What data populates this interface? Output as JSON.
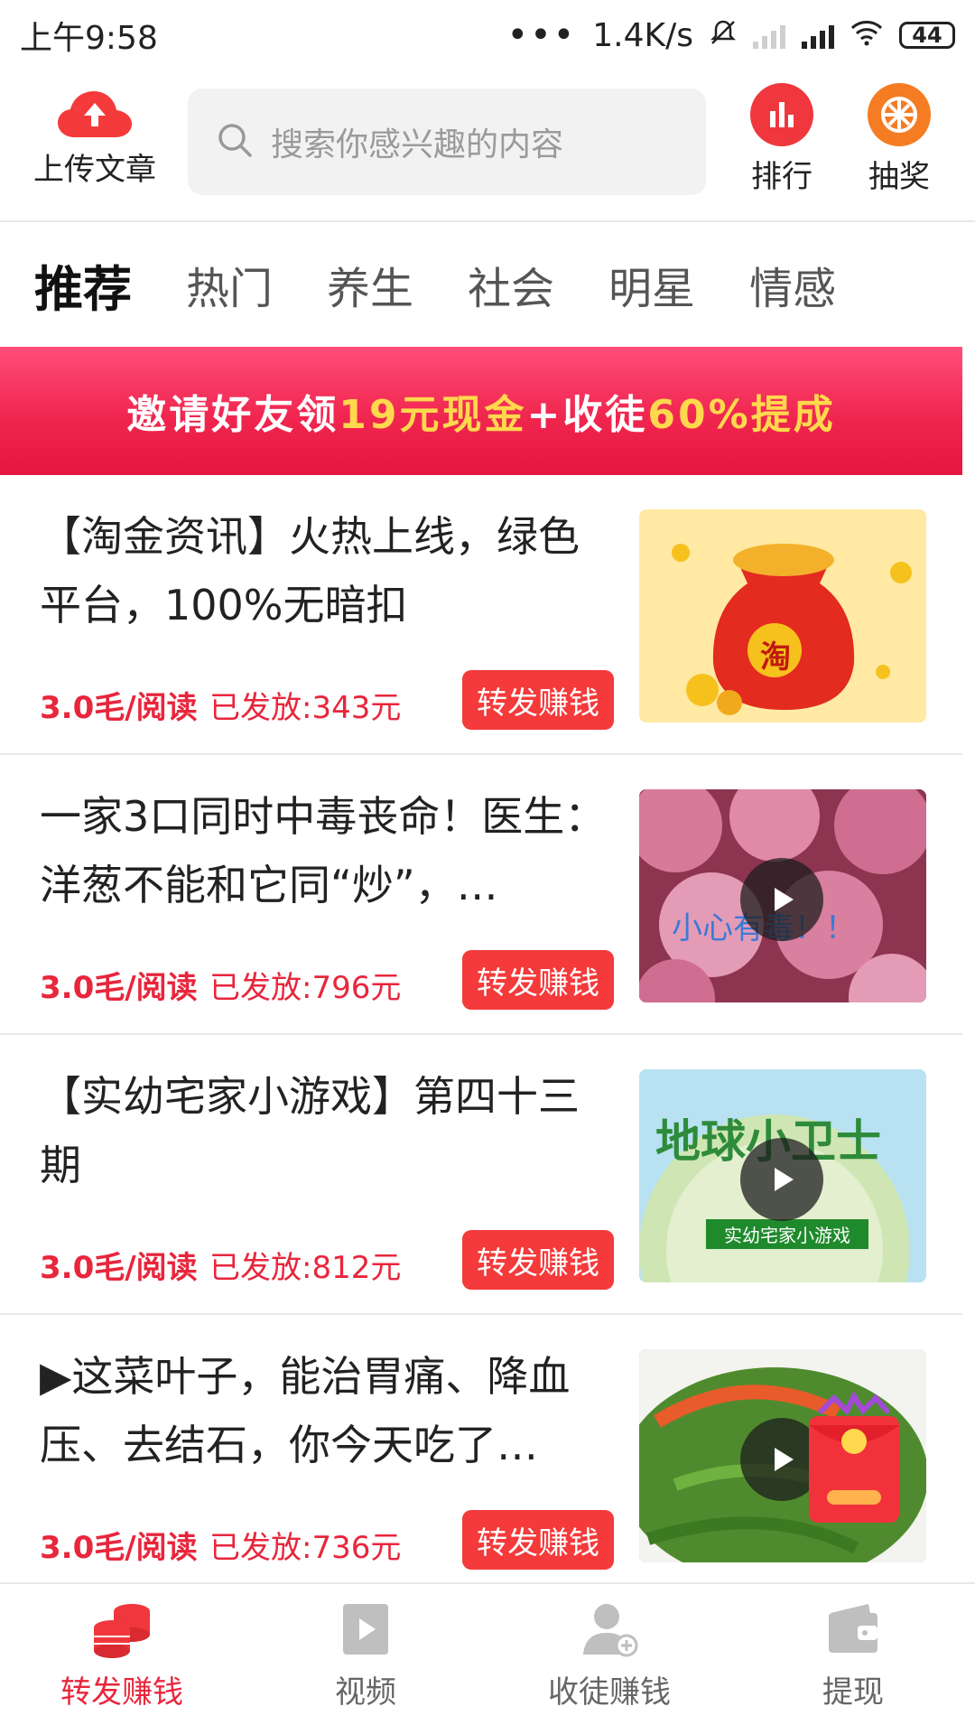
{
  "status_bar": {
    "time": "上午9:58",
    "network_speed": "1.4K/s",
    "battery": "44"
  },
  "header": {
    "upload_label": "上传文章",
    "search_placeholder": "搜索你感兴趣的内容",
    "rank_label": "排行",
    "lottery_label": "抽奖"
  },
  "tabs": [
    "推荐",
    "热门",
    "养生",
    "社会",
    "明星",
    "情感"
  ],
  "banner": {
    "part1": "邀请好友领",
    "part2": "19元现金",
    "part3": "+收徒",
    "part4": "60%提成"
  },
  "articles": [
    {
      "title": "【淘金资讯】火热上线，绿色平台，100%无暗扣",
      "price": "3.0毛/阅读",
      "paid": "已发放:343元",
      "button": "转发赚钱",
      "thumb_text": "淘"
    },
    {
      "title": "一家3口同时中毒丧命！医生：洋葱不能和它同“炒”，…",
      "price": "3.0毛/阅读",
      "paid": "已发放:796元",
      "button": "转发赚钱",
      "thumb_text": "小心有毒！！"
    },
    {
      "title": "【实幼宅家小游戏】第四十三期",
      "price": "3.0毛/阅读",
      "paid": "已发放:812元",
      "button": "转发赚钱",
      "thumb_text": "地球小卫士",
      "thumb_sub": "实幼宅家小游戏"
    },
    {
      "title": "▶这菜叶子，能治胃痛、降血压、去结石，你今天吃了…",
      "price": "3.0毛/阅读",
      "paid": "已发放:736元",
      "button": "转发赚钱"
    }
  ],
  "bottom_nav": [
    {
      "label": "转发赚钱",
      "active": true
    },
    {
      "label": "视频"
    },
    {
      "label": "收徒赚钱"
    },
    {
      "label": "提现"
    }
  ],
  "colors": {
    "accent": "#f43a3a",
    "price_red": "#e8263c",
    "rank_bg": "#f0373d",
    "lottery_bg": "#f57c22"
  }
}
